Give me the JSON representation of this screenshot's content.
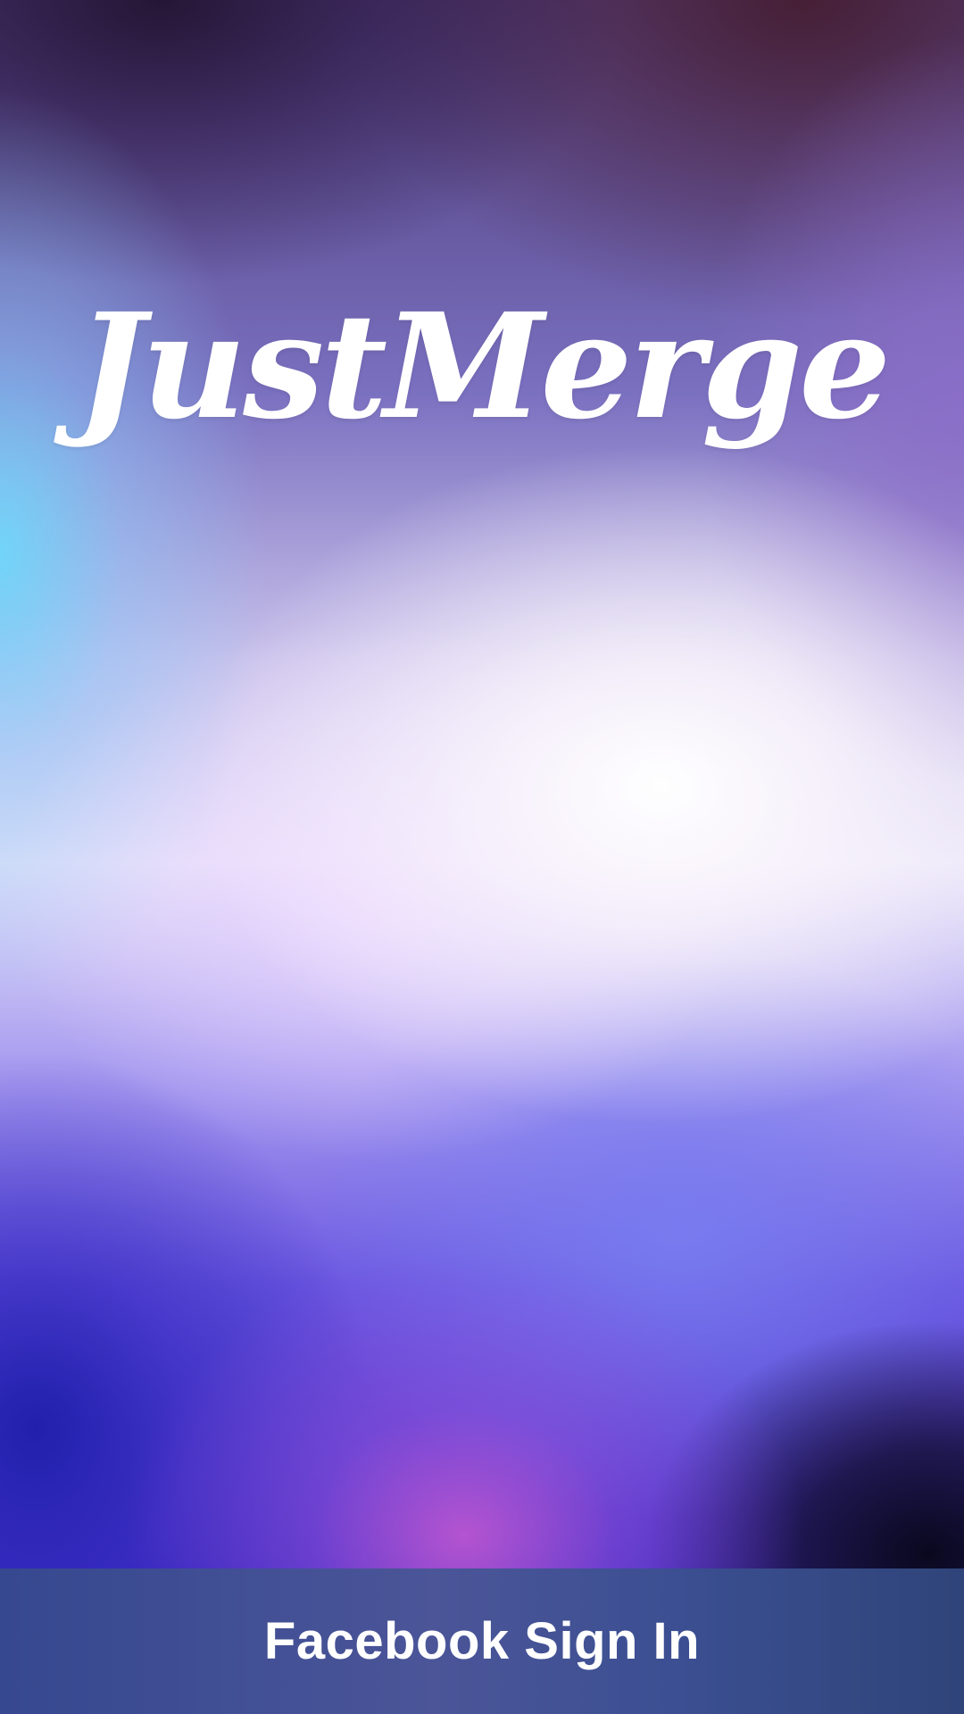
{
  "app": {
    "logo_text": "JustMerge"
  },
  "signin": {
    "facebook_label": "Facebook Sign In"
  },
  "colors": {
    "facebook_bar": "#3b4c92",
    "text": "#ffffff"
  }
}
